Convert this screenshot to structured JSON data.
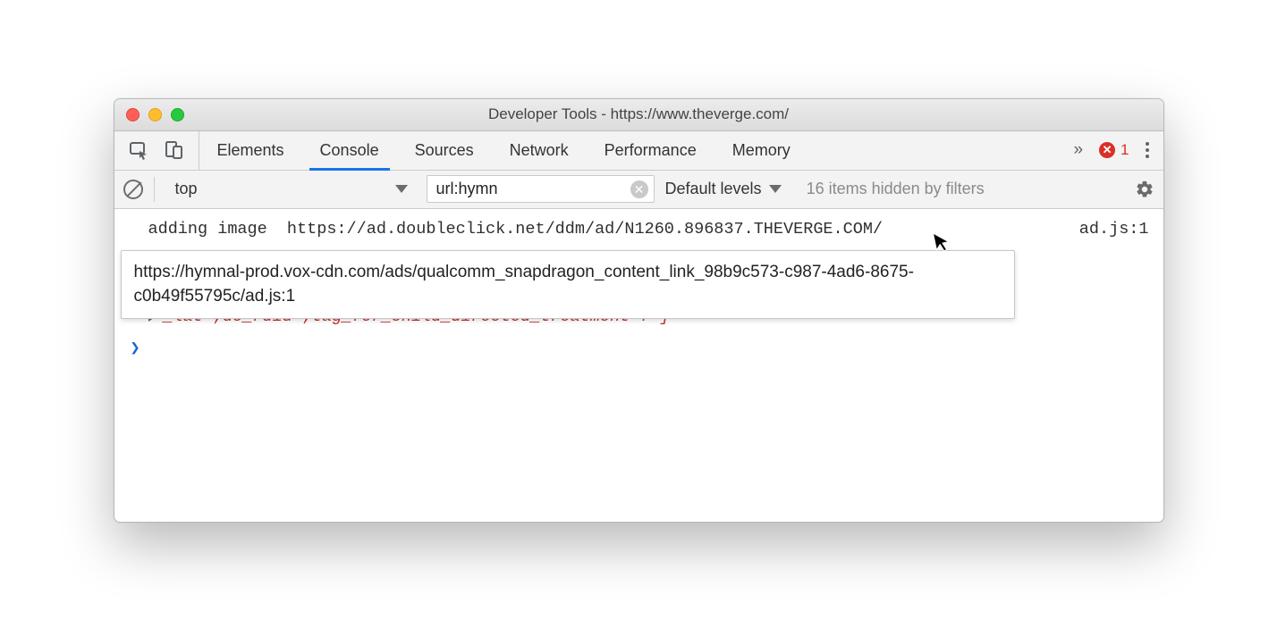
{
  "window": {
    "title": "Developer Tools - https://www.theverge.com/"
  },
  "tabs": [
    "Elements",
    "Console",
    "Sources",
    "Network",
    "Performance",
    "Memory"
  ],
  "active_tab_index": 1,
  "errors": {
    "count": "1"
  },
  "filterbar": {
    "context": "top",
    "filter_value": "url:hymn",
    "levels_label": "Default levels",
    "hidden_msg": "16 items hidden by filters"
  },
  "log": {
    "line1_msg": "adding image  https://ad.doubleclick.net/ddm/ad/N1260.896837.THEVERGE.COM/",
    "line1_src": "ad.js:1",
    "tooltip": "https://hymnal-prod.vox-cdn.com/ads/qualcomm_snapdragon_content_link_98b9c573-c987-4ad6-8675-c0b49f55795c/ad.js:1",
    "expanded_frag": "_lat=;dc_rdid=;tag_for_child_directed_treatment=?",
    "expanded_close_quote": "\"",
    "expanded_close_bracket": "]"
  }
}
